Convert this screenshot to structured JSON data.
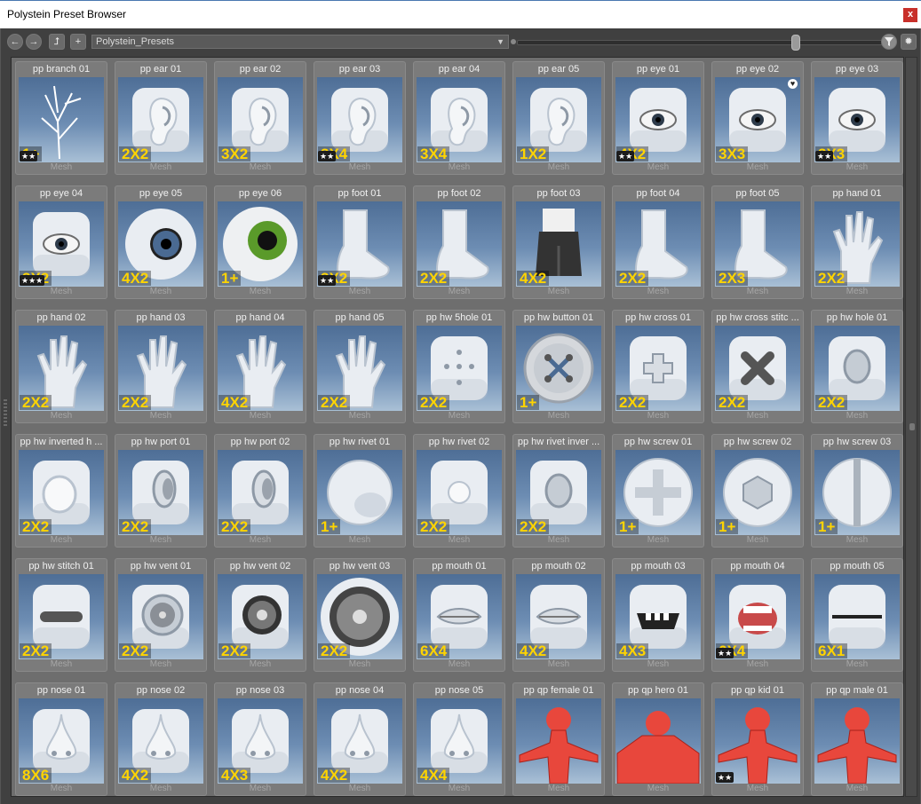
{
  "window": {
    "title": "Polystein Preset Browser",
    "close_label": "x"
  },
  "toolbar": {
    "back_icon": "arrow-left-icon",
    "forward_icon": "arrow-right-icon",
    "up_icon": "folder-up-icon",
    "add_icon": "plus-icon",
    "path_value": "Polystein_Presets",
    "zoom_level": 0.77,
    "filter_icon": "filter-icon",
    "settings_icon": "gear-icon"
  },
  "colors": {
    "badge": "#ffd400",
    "thumb_bg": "#5f7fa8",
    "cell_bg": "#7b7b7b",
    "close": "#c8302a"
  },
  "presets": [
    {
      "name": "pp branch 01",
      "size": "1+",
      "stars": "★★",
      "type": "Mesh",
      "kind": "branch"
    },
    {
      "name": "pp ear 01",
      "size": "2X2",
      "type": "Mesh",
      "kind": "ear"
    },
    {
      "name": "pp ear 02",
      "size": "3X2",
      "type": "Mesh",
      "kind": "ear"
    },
    {
      "name": "pp ear 03",
      "size": "3X4",
      "stars": "★★",
      "type": "Mesh",
      "kind": "ear"
    },
    {
      "name": "pp ear 04",
      "size": "3X4",
      "type": "Mesh",
      "kind": "ear"
    },
    {
      "name": "pp ear 05",
      "size": "1X2",
      "type": "Mesh",
      "kind": "ear"
    },
    {
      "name": "pp eye 01",
      "size": "4X2",
      "stars": "★★",
      "type": "Mesh",
      "kind": "eye"
    },
    {
      "name": "pp eye 02",
      "size": "3X3",
      "heart": "♥",
      "type": "Mesh",
      "kind": "eye"
    },
    {
      "name": "pp eye 03",
      "size": "3X3",
      "stars": "★★",
      "type": "Mesh",
      "kind": "eye"
    },
    {
      "name": "pp eye 04",
      "size": "3X2",
      "stars": "★★★",
      "type": "Mesh",
      "kind": "eye"
    },
    {
      "name": "pp eye 05",
      "size": "4X2",
      "type": "Mesh",
      "kind": "eyeball"
    },
    {
      "name": "pp eye 06",
      "size": "1+",
      "type": "Mesh",
      "kind": "greeneye"
    },
    {
      "name": "pp foot 01",
      "size": "3X2",
      "stars": "★★",
      "type": "Mesh",
      "kind": "foot"
    },
    {
      "name": "pp foot 02",
      "size": "2X2",
      "type": "Mesh",
      "kind": "foot"
    },
    {
      "name": "pp foot 03",
      "size": "4X2",
      "type": "Mesh",
      "kind": "hoof"
    },
    {
      "name": "pp foot 04",
      "size": "2X2",
      "type": "Mesh",
      "kind": "foot"
    },
    {
      "name": "pp foot 05",
      "size": "2X3",
      "type": "Mesh",
      "kind": "foot"
    },
    {
      "name": "pp hand 01",
      "size": "2X2",
      "type": "Mesh",
      "kind": "hand"
    },
    {
      "name": "pp hand 02",
      "size": "2X2",
      "type": "Mesh",
      "kind": "hand"
    },
    {
      "name": "pp hand 03",
      "size": "2X2",
      "type": "Mesh",
      "kind": "hand"
    },
    {
      "name": "pp hand 04",
      "size": "4X2",
      "type": "Mesh",
      "kind": "hand"
    },
    {
      "name": "pp hand 05",
      "size": "2X2",
      "type": "Mesh",
      "kind": "hand"
    },
    {
      "name": "pp hw 5hole 01",
      "size": "2X2",
      "type": "Mesh",
      "kind": "fivehole"
    },
    {
      "name": "pp hw button 01",
      "size": "1+",
      "type": "Mesh",
      "kind": "button"
    },
    {
      "name": "pp hw cross 01",
      "size": "2X2",
      "type": "Mesh",
      "kind": "cross"
    },
    {
      "name": "pp hw cross stitc ...",
      "size": "2X2",
      "type": "Mesh",
      "kind": "xstitch"
    },
    {
      "name": "pp hw hole 01",
      "size": "2X2",
      "type": "Mesh",
      "kind": "hole"
    },
    {
      "name": "pp hw inverted h ...",
      "size": "2X2",
      "type": "Mesh",
      "kind": "disc"
    },
    {
      "name": "pp hw port 01",
      "size": "2X2",
      "type": "Mesh",
      "kind": "port"
    },
    {
      "name": "pp hw port 02",
      "size": "2X2",
      "type": "Mesh",
      "kind": "port"
    },
    {
      "name": "pp hw rivet 01",
      "size": "1+",
      "type": "Mesh",
      "kind": "sphere"
    },
    {
      "name": "pp hw rivet 02",
      "size": "2X2",
      "type": "Mesh",
      "kind": "rivet"
    },
    {
      "name": "pp hw rivet inver ...",
      "size": "2X2",
      "type": "Mesh",
      "kind": "hole"
    },
    {
      "name": "pp hw screw 01",
      "size": "1+",
      "type": "Mesh",
      "kind": "screwcross"
    },
    {
      "name": "pp hw screw 02",
      "size": "1+",
      "type": "Mesh",
      "kind": "screwhex"
    },
    {
      "name": "pp hw screw 03",
      "size": "1+",
      "type": "Mesh",
      "kind": "screwslot"
    },
    {
      "name": "pp hw stitch 01",
      "size": "2X2",
      "type": "Mesh",
      "kind": "stitch"
    },
    {
      "name": "pp hw vent 01",
      "size": "2X2",
      "type": "Mesh",
      "kind": "vent"
    },
    {
      "name": "pp hw vent 02",
      "size": "2X2",
      "type": "Mesh",
      "kind": "vent2"
    },
    {
      "name": "pp hw vent 03",
      "size": "2X2",
      "type": "Mesh",
      "kind": "turbine"
    },
    {
      "name": "pp mouth 01",
      "size": "6X4",
      "type": "Mesh",
      "kind": "mouth"
    },
    {
      "name": "pp mouth 02",
      "size": "4X2",
      "type": "Mesh",
      "kind": "mouth"
    },
    {
      "name": "pp mouth 03",
      "size": "4X3",
      "type": "Mesh",
      "kind": "mouthteeth"
    },
    {
      "name": "pp mouth 04",
      "size": "6X4",
      "stars": "★★",
      "type": "Mesh",
      "kind": "mouthopen"
    },
    {
      "name": "pp mouth 05",
      "size": "6X1",
      "type": "Mesh",
      "kind": "mouthline"
    },
    {
      "name": "pp nose 01",
      "size": "8X6",
      "type": "Mesh",
      "kind": "nose"
    },
    {
      "name": "pp nose 02",
      "size": "4X2",
      "type": "Mesh",
      "kind": "nose"
    },
    {
      "name": "pp nose 03",
      "size": "4X3",
      "type": "Mesh",
      "kind": "nose"
    },
    {
      "name": "pp nose 04",
      "size": "4X2",
      "type": "Mesh",
      "kind": "nose"
    },
    {
      "name": "pp nose 05",
      "size": "4X4",
      "type": "Mesh",
      "kind": "nose"
    },
    {
      "name": "pp qp female 01",
      "type": "Mesh",
      "kind": "body"
    },
    {
      "name": "pp qp hero 01",
      "type": "Mesh",
      "kind": "hero"
    },
    {
      "name": "pp qp kid 01",
      "stars": "★★",
      "type": "Mesh",
      "kind": "body"
    },
    {
      "name": "pp qp male 01",
      "type": "Mesh",
      "kind": "body"
    }
  ]
}
